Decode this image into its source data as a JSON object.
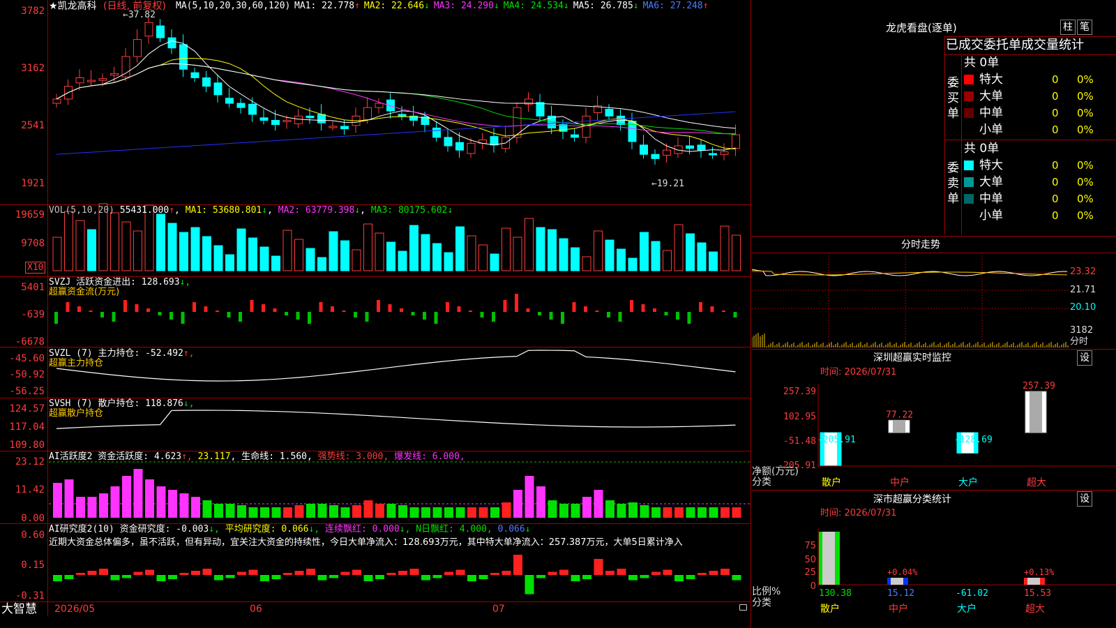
{
  "chart": {
    "title": "★凯龙高科",
    "period": "(日线, 前复权)",
    "ma_label": "MA(5,10,20,30,60,120)",
    "ma": [
      {
        "name": "MA1:",
        "value": "22.778",
        "arrow": "↑",
        "color": "#ffffff"
      },
      {
        "name": "MA2:",
        "value": "22.646",
        "arrow": "↓",
        "color": "#ffff00"
      },
      {
        "name": "MA3:",
        "value": "24.290",
        "arrow": "↓",
        "color": "#ff33ff"
      },
      {
        "name": "MA4:",
        "value": "24.534",
        "arrow": "↓",
        "color": "#00e000"
      },
      {
        "name": "MA5:",
        "value": "26.785",
        "arrow": "↓",
        "color": "#ffffff"
      },
      {
        "name": "MA6:",
        "value": "27.248",
        "arrow": "↑",
        "color": "#4c7dff"
      }
    ],
    "price_axis": [
      "3782",
      "3162",
      "2541",
      "1921"
    ],
    "high_label": "←37.82",
    "low_label": "←19.21"
  },
  "vol": {
    "label": "VOL(5,10,20)",
    "value": "55431.000",
    "arrow": "↑",
    "ma1": "MA1: 53680.801",
    "ma1_arrow": "↓",
    "ma2": "MA2: 63779.398",
    "ma2_arrow": "↓",
    "ma3": "MA3: 80175.602",
    "ma3_arrow": "↓",
    "axis": [
      "19659",
      "9708"
    ],
    "unit": "X10"
  },
  "svzj": {
    "label": "SVZJ  活跃资金进出: 128.693",
    "arrow": "↓,",
    "sub": "超赢资金流(万元)",
    "axis": [
      "5401",
      "-639",
      "-6678"
    ]
  },
  "svzl": {
    "label": "SVZL (7) 主力持仓: -52.492",
    "arrow": "↑,",
    "sub": "超赢主力持仓",
    "axis": [
      "-45.60",
      "-50.92",
      "-56.25"
    ]
  },
  "svsh": {
    "label": "SVSH (7) 散户持仓: 118.876",
    "arrow": "↓,",
    "sub": "超赢散户持仓",
    "axis": [
      "124.57",
      "117.04",
      "109.80"
    ]
  },
  "ai_active": {
    "label": "AI活跃度2 资金活跃度: 4.623",
    "a1": "↑,",
    "v2": "23.117",
    "a2": ",",
    "v3": "生命线: 1.560,",
    "v4": "强势线: 3.000,",
    "v5": "爆发线: 6.000,",
    "axis": [
      "23.12",
      "11.42",
      "0.00"
    ]
  },
  "ai_research": {
    "label": "AI研究度2(10) 资金研究度: -0.003",
    "a1": "↓,",
    "v2": "平均研究度: 0.066",
    "a2": "↓,",
    "v3": "连续飘红: 0.000",
    "a3": "↓,",
    "v4": "N日飘红: 4.000,",
    "v5": "0.066",
    "a5": "↓",
    "comment": "近期大资金总体偏多，虽不活跃，但有异动，宜关注大资金的持续性，今日大单净流入：128.693万元，其中特大单净流入：257.387万元，大单5日累计净入",
    "axis": [
      "0.60",
      "0.15",
      "-0.31"
    ]
  },
  "bottom": {
    "brand": "大智慧",
    "dates": [
      "2026/05",
      "06",
      "07"
    ]
  },
  "panel": {
    "title": "龙虎看盘(逐单)",
    "btn1": "柱",
    "btn2": "笔",
    "header": "已成交委托单成交量统计",
    "buy_label": "委买单",
    "sell_label": "委卖单",
    "buy_total": "共 0单",
    "sell_total": "共 0单",
    "buy_rows": [
      {
        "name": "特大",
        "count": "0",
        "pct": "0%",
        "color": "#ff0000"
      },
      {
        "name": "大单",
        "count": "0",
        "pct": "0%",
        "color": "#990000"
      },
      {
        "name": "中单",
        "count": "0",
        "pct": "0%",
        "color": "#660000"
      },
      {
        "name": "小单",
        "count": "0",
        "pct": "0%",
        "color": "#000000"
      }
    ],
    "sell_rows": [
      {
        "name": "特大",
        "count": "0",
        "pct": "0%",
        "color": "#00ffff"
      },
      {
        "name": "大单",
        "count": "0",
        "pct": "0%",
        "color": "#009999"
      },
      {
        "name": "中单",
        "count": "0",
        "pct": "0%",
        "color": "#006666"
      },
      {
        "name": "小单",
        "count": "0",
        "pct": "0%",
        "color": "#000000"
      }
    ]
  },
  "intraday": {
    "title": "分时走势",
    "axis": [
      "23.32",
      "21.71",
      "20.10",
      "3182",
      "分时"
    ]
  },
  "monitor": {
    "title": "深圳超赢实时监控",
    "btn": "设",
    "time": "时间: 2026/07/31",
    "axis": [
      "257.39",
      "102.95",
      "-51.48",
      "-205.91"
    ],
    "axis_caption": "净额(万元)",
    "cat_caption": "分类",
    "categories": [
      "散户",
      "中户",
      "大户",
      "超大"
    ],
    "values": [
      -205.91,
      77.22,
      -128.69,
      257.39
    ],
    "value_labels": [
      "-205.91",
      "77.22",
      "-128.69",
      "257.39"
    ]
  },
  "stats": {
    "title": "深市超赢分类统计",
    "btn": "设",
    "time": "时间: 2026/07/31",
    "axis": [
      "75",
      "50",
      "25",
      "0"
    ],
    "axis_caption": "比例%",
    "cat_caption": "分类",
    "categories": [
      "散户",
      "中户",
      "大户",
      "超大"
    ],
    "pct_labels": [
      "",
      "+0.04%",
      "",
      "+0.13%"
    ],
    "values": [
      "130.38",
      "15.12",
      "-61.02",
      "15.53"
    ]
  }
}
